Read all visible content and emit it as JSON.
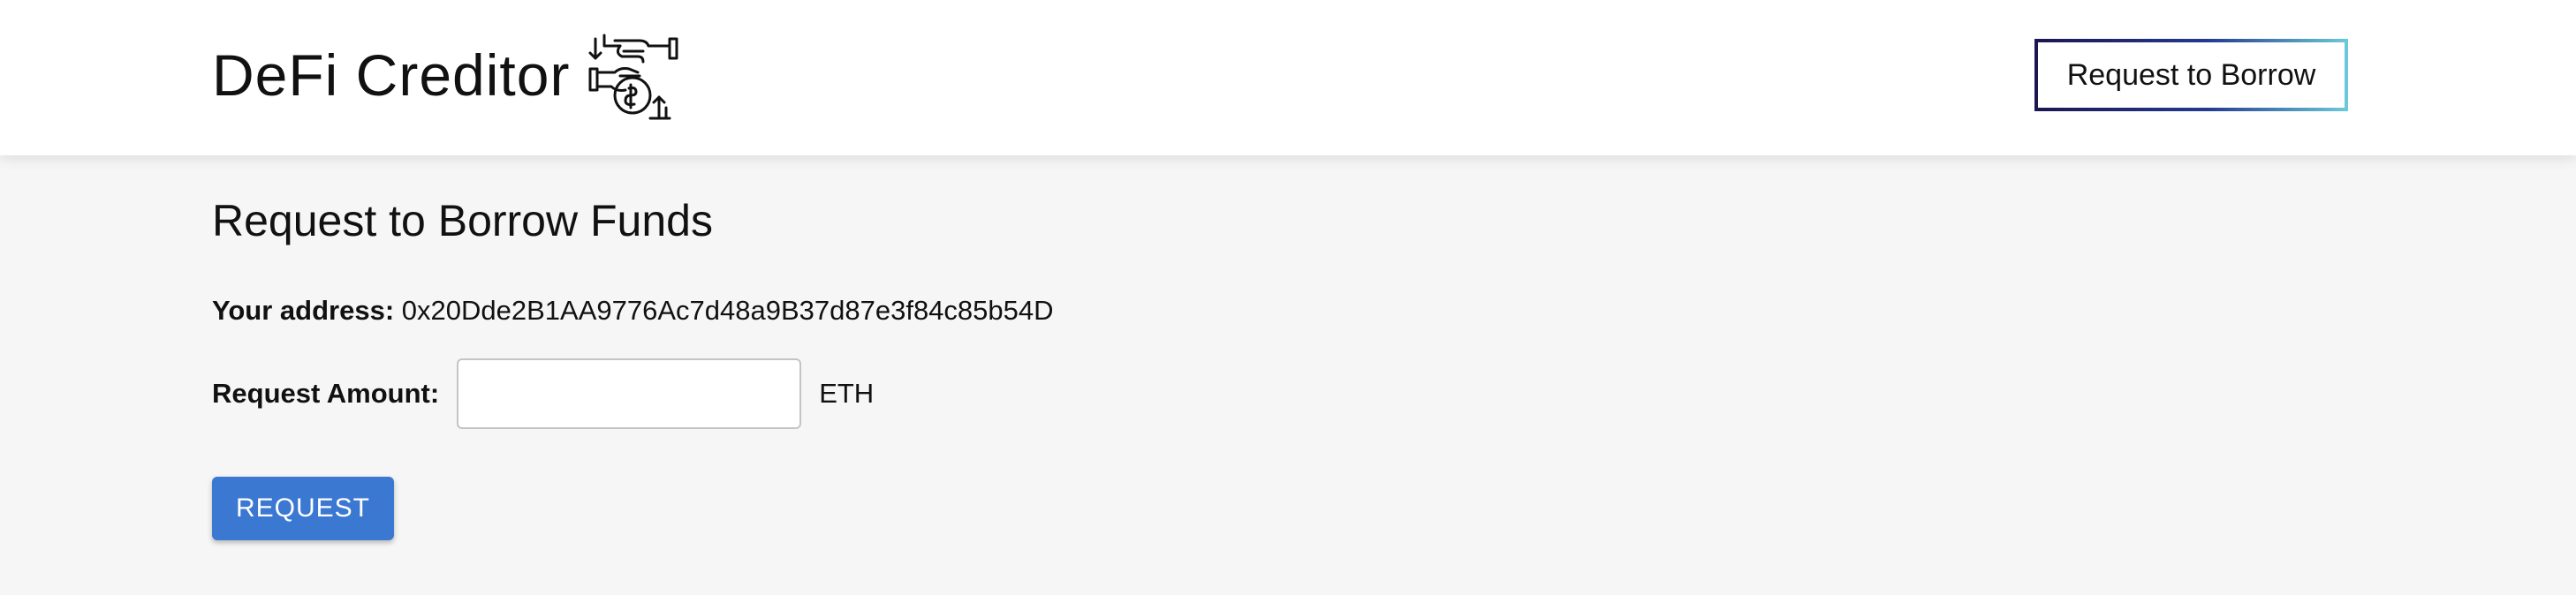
{
  "header": {
    "brand": "DeFi Creditor",
    "brand_icon": "handshake-coin-exchange-icon",
    "nav_button_label": "Request to Borrow"
  },
  "main": {
    "title": "Request to Borrow Funds",
    "address_label": "Your address:",
    "address_value": "0x20Dde2B1AA9776Ac7d48a9B37d87e3f84c85b54D",
    "amount_label": "Request Amount:",
    "amount_value": "",
    "amount_placeholder": "",
    "amount_unit": "ETH",
    "submit_label": "REQUEST"
  },
  "colors": {
    "submit_button": "#3b78d2",
    "nav_border_start": "#1c1652",
    "nav_border_end": "#6ccad8"
  }
}
